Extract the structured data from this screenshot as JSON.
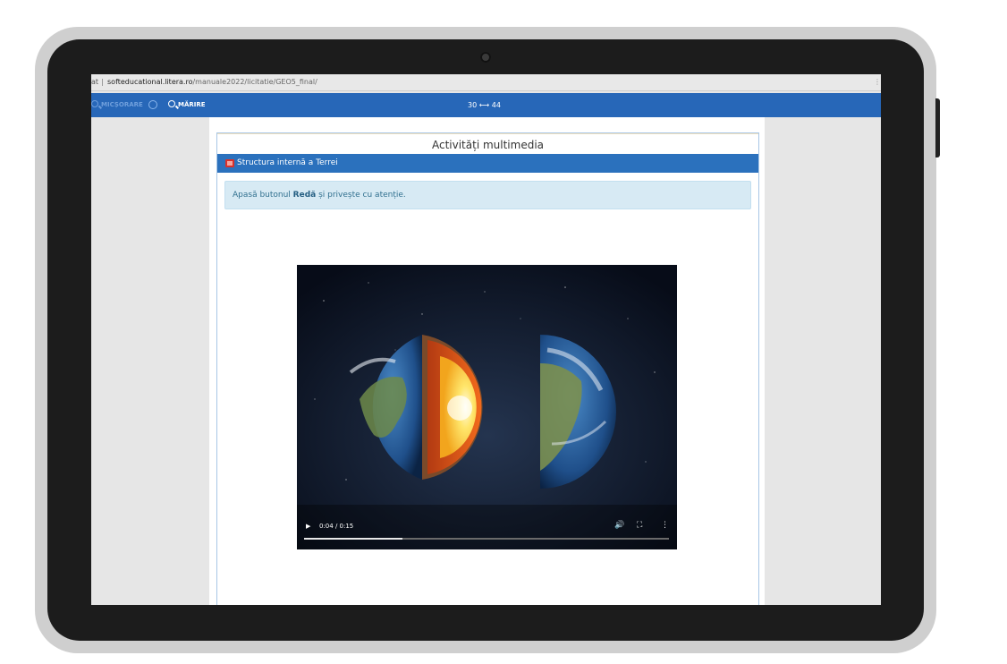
{
  "browser": {
    "url_prefix": "at",
    "url_host": "softeducational.litera.ro",
    "url_path": "/manuale2022/licitatie/GEO5_final/"
  },
  "toolbar": {
    "zoom_out_label": "MICȘORARE",
    "zoom_in_label": "MĂRIRE",
    "pages_label": "30 ⟷ 44"
  },
  "content": {
    "section_title": "Activități multimedia",
    "header_label": "Structura internă a Terrei",
    "instruction_prefix": "Apasă butonul ",
    "instruction_bold": "Redă",
    "instruction_suffix": " și privește cu atenție."
  },
  "video": {
    "time": "0:04 / 0:15",
    "progress_fraction": 0.27,
    "icons": [
      "play-icon",
      "volume-icon",
      "fullscreen-icon",
      "more-options-icon"
    ]
  },
  "colors": {
    "toolbar": "#2767b8",
    "header": "#2b71bd",
    "info_bg": "#d7eaf4"
  }
}
